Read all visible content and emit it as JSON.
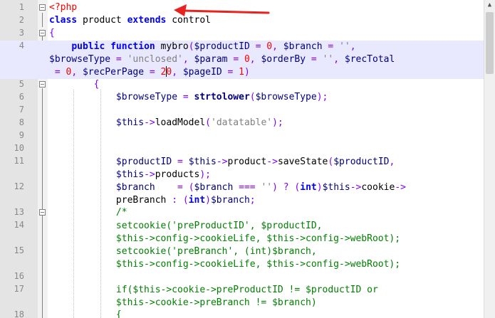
{
  "lines": [
    {
      "num": "1",
      "code": "<?php"
    },
    {
      "num": "2",
      "code": "class product extends control"
    },
    {
      "num": "3",
      "code": "{"
    },
    {
      "num": "4",
      "code": "    public function mybro($productID = 0, $branch = '',\n$browseType = 'unclosed', $param = 0, $orderBy = '', $recTotal\n = 0, $recPerPage = 20, $pageID = 1)"
    },
    {
      "num": "5",
      "code": "        {"
    },
    {
      "num": "6",
      "code": "            $browseType = strtolower($browseType);"
    },
    {
      "num": "7",
      "code": ""
    },
    {
      "num": "8",
      "code": "            $this->loadModel('datatable');"
    },
    {
      "num": "9",
      "code": ""
    },
    {
      "num": "10",
      "code": ""
    },
    {
      "num": "11",
      "code": "            $productID = $this->product->saveState($productID,\n            $this->products);"
    },
    {
      "num": "12",
      "code": "            $branch    = ($branch === '') ? (int)$this->cookie->\n            preBranch : (int)$branch;"
    },
    {
      "num": "13",
      "code": "            /*"
    },
    {
      "num": "14",
      "code": "            setcookie('preProductID', $productID,\n            $this->config->cookieLife, $this->config->webRoot);"
    },
    {
      "num": "15",
      "code": "            setcookie('preBranch', (int)$branch,\n            $this->config->cookieLife, $this->config->webRoot);"
    },
    {
      "num": "16",
      "code": ""
    },
    {
      "num": "17",
      "code": "            if($this->cookie->preProductID != $productID or\n            $this->cookie->preBranch != $branch)"
    },
    {
      "num": "18",
      "code": "            {"
    }
  ],
  "scrollbar": {
    "up_arrow": "▲"
  }
}
